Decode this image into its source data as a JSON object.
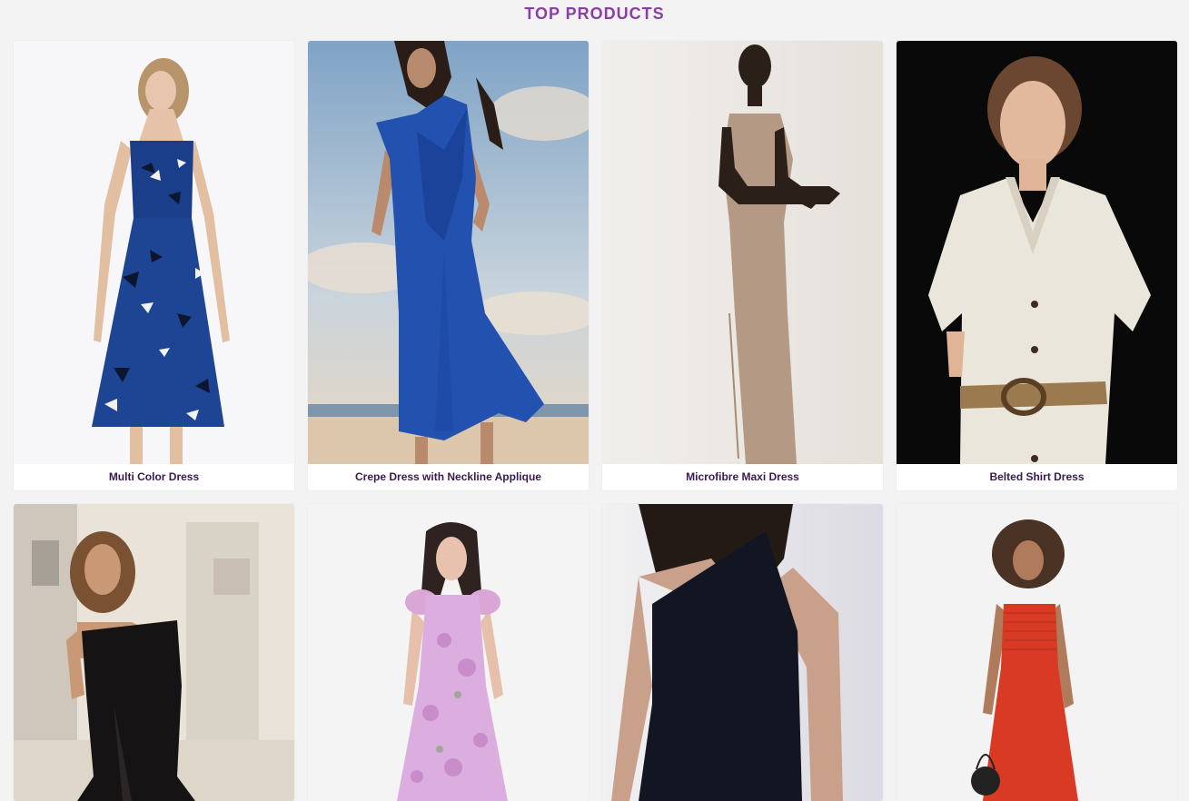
{
  "header": {
    "title": "TOP PRODUCTS"
  },
  "colors": {
    "title": "#8a3ea6",
    "caption_text": "#3a1a4e",
    "page_bg": "#f3f3f4"
  },
  "products": [
    {
      "name": "Multi Color Dress",
      "image_icon": "dress-photo-blue-floral"
    },
    {
      "name": "Crepe Dress with Neckline Applique",
      "image_icon": "dress-photo-cobalt-beach"
    },
    {
      "name": "Microfibre Maxi Dress",
      "image_icon": "dress-photo-beige-maxi"
    },
    {
      "name": "Belted Shirt Dress",
      "image_icon": "dress-photo-white-shirt"
    },
    {
      "name": "",
      "image_icon": "dress-photo-black-strapless"
    },
    {
      "name": "",
      "image_icon": "dress-photo-pink-floral"
    },
    {
      "name": "",
      "image_icon": "dress-photo-black-one-shoulder"
    },
    {
      "name": "",
      "image_icon": "dress-photo-red-smocked"
    }
  ]
}
